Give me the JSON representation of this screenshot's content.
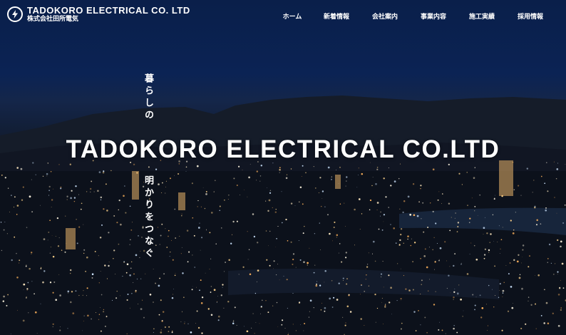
{
  "brand": {
    "name_en": "TADOKORO ELECTRICAL CO. LTD",
    "name_ja": "株式会社田所電気",
    "logo_icon": "lightning-circle-icon"
  },
  "nav": [
    {
      "label": "ホーム"
    },
    {
      "label": "新着情報"
    },
    {
      "label": "会社案内"
    },
    {
      "label": "事業内容"
    },
    {
      "label": "施工実績"
    },
    {
      "label": "採用情報"
    }
  ],
  "hero": {
    "tagline_top": "暮らしの",
    "title": "TADOKORO ELECTRICAL CO.LTD",
    "tagline_bottom": "明かりをつなぐ"
  },
  "colors": {
    "sky_top": "#0a1f4a",
    "text": "#ffffff",
    "city_light": "#ffd48a"
  }
}
